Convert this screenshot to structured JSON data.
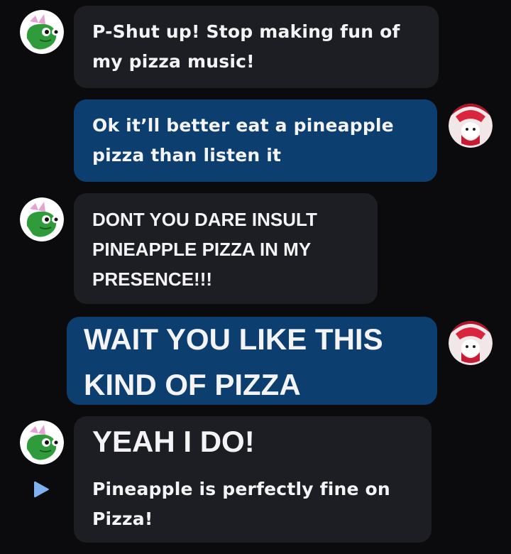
{
  "messages": [
    {
      "side": "left",
      "lines": [
        "P-Shut up! Stop making fun of",
        "my pizza music!"
      ]
    },
    {
      "side": "right",
      "lines": [
        "Ok it’ll better eat a pineapple",
        "pizza than listen it"
      ]
    },
    {
      "side": "left",
      "lines": [
        "DONT YOU DARE INSULT",
        "PINEAPPLE PIZZA IN MY",
        "PRESENCE!!!"
      ]
    },
    {
      "side": "right",
      "lines": [
        "WAIT YOU LIKE THIS",
        "KIND OF PIZZA"
      ]
    },
    {
      "side": "left",
      "heading": "YEAH I DO!",
      "lines": [
        "Pineapple is perfectly fine on",
        "Pizza!"
      ]
    }
  ],
  "icons": {
    "left_avatar": "green-character-avatar-icon",
    "right_avatar": "red-character-avatar-icon",
    "play": "play-icon"
  },
  "colors": {
    "background": "#0b0b0d",
    "left_bubble": "#1d1e23",
    "right_bubble": "#0c3f6f",
    "play_icon": "#7fb2f0"
  }
}
